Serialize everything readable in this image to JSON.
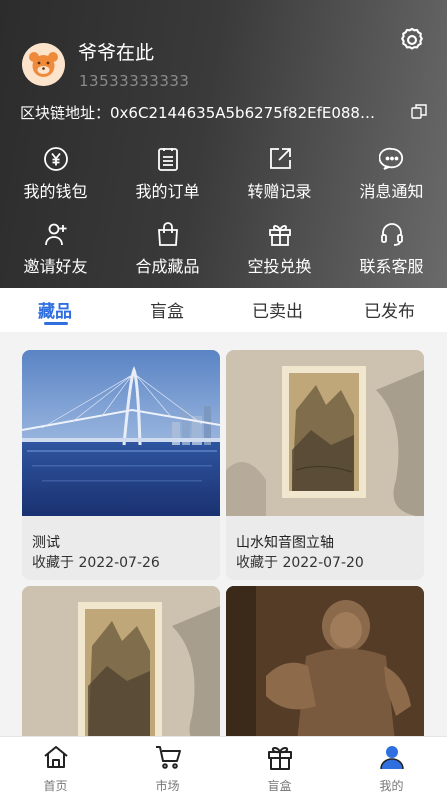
{
  "user": {
    "name": "爷爷在此",
    "phone": "13533333333"
  },
  "chain_address": "区块链地址：0x6C2144635A5b6275f82EfE0886...",
  "actions": [
    {
      "label": "我的钱包",
      "icon": "wallet-icon"
    },
    {
      "label": "我的订单",
      "icon": "order-icon"
    },
    {
      "label": "转赠记录",
      "icon": "transfer-icon"
    },
    {
      "label": "消息通知",
      "icon": "message-icon"
    },
    {
      "label": "邀请好友",
      "icon": "invite-icon"
    },
    {
      "label": "合成藏品",
      "icon": "compose-icon"
    },
    {
      "label": "空投兑换",
      "icon": "gift-icon"
    },
    {
      "label": "联系客服",
      "icon": "headset-icon"
    }
  ],
  "tabs": [
    {
      "label": "藏品",
      "active": true
    },
    {
      "label": "盲盒",
      "active": false
    },
    {
      "label": "已卖出",
      "active": false
    },
    {
      "label": "已发布",
      "active": false
    }
  ],
  "collections": [
    {
      "title": "测试",
      "date": "收藏于 2022-07-26"
    },
    {
      "title": "山水知音图立轴",
      "date": "收藏于 2022-07-20"
    },
    {
      "title": "",
      "date": ""
    },
    {
      "title": "",
      "date": ""
    }
  ],
  "bottom_nav": [
    {
      "label": "首页",
      "icon": "home-icon",
      "active": false
    },
    {
      "label": "市场",
      "icon": "cart-icon",
      "active": false
    },
    {
      "label": "盲盒",
      "icon": "gift-box-icon",
      "active": false
    },
    {
      "label": "我的",
      "icon": "user-icon",
      "active": true
    }
  ],
  "colors": {
    "accent": "#2f6fe0",
    "header_dark": "#2c2c2c",
    "card_bg": "#ebebeb"
  }
}
